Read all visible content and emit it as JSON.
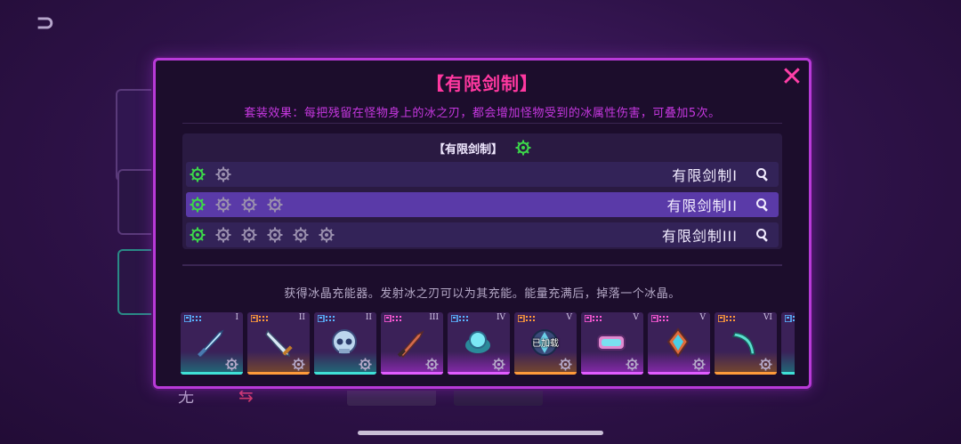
{
  "modal": {
    "title": "【有限剑制】",
    "set_effect": "套装效果：每把残留在怪物身上的冰之刃，都会增加怪物受到的冰属性伤害，可叠加5次。",
    "close_label": "✕"
  },
  "set_box": {
    "name": "【有限剑制】",
    "tiers": [
      {
        "name": "有限剑制I",
        "active_gears": 1,
        "total_gears": 2
      },
      {
        "name": "有限剑制II",
        "active_gears": 1,
        "total_gears": 4
      },
      {
        "name": "有限剑制III",
        "active_gears": 1,
        "total_gears": 6
      }
    ],
    "selected_tier": 1
  },
  "description": "获得冰晶充能器。发射冰之刃可以为其充能。能量充满后，掉落一个冰晶。",
  "cards": [
    {
      "roman": "I",
      "rarity": "teal",
      "item_icon": "sword-icon",
      "badge_color": "#5ab4ff"
    },
    {
      "roman": "II",
      "rarity": "orange",
      "item_icon": "dagger-icon",
      "badge_color": "#ff9a3a"
    },
    {
      "roman": "II",
      "rarity": "teal",
      "item_icon": "skull-helm-icon",
      "badge_color": "#5ab4ff"
    },
    {
      "roman": "III",
      "rarity": "purple",
      "item_icon": "blade-icon",
      "badge_color": "#ff5ad8"
    },
    {
      "roman": "IV",
      "rarity": "purple",
      "item_icon": "orb-icon",
      "badge_color": "#5ab4ff"
    },
    {
      "roman": "V",
      "rarity": "orange",
      "item_icon": "crystal-icon",
      "badge_color": "#ff9a3a",
      "equipped_label": "已加载"
    },
    {
      "roman": "V",
      "rarity": "purple",
      "item_icon": "goggles-icon",
      "badge_color": "#ff5ad8"
    },
    {
      "roman": "V",
      "rarity": "purple",
      "item_icon": "gem-icon",
      "badge_color": "#ff5ad8"
    },
    {
      "roman": "VI",
      "rarity": "orange",
      "item_icon": "curved-blade-icon",
      "badge_color": "#ff9a3a"
    },
    {
      "roman": "",
      "rarity": "teal",
      "item_icon": "partial-card-icon",
      "badge_color": "#5ab4ff"
    }
  ],
  "background": {
    "left_label": "无"
  },
  "colors": {
    "accent": "#ff38a0",
    "border": "#b83ad8",
    "gear_active": "#3cd84a",
    "gear_inactive": "#9a8fae"
  }
}
